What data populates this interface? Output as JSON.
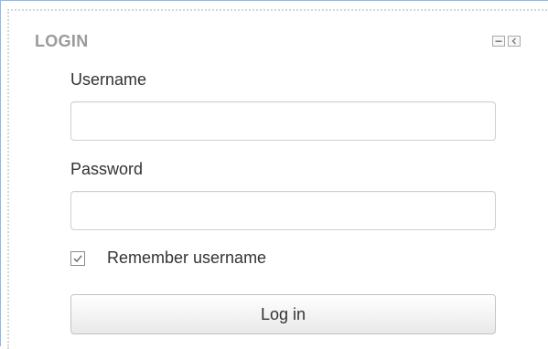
{
  "login_block": {
    "title": "LOGIN",
    "controls": [
      {
        "name": "minimize-icon"
      },
      {
        "name": "dock-icon"
      }
    ],
    "username": {
      "label": "Username",
      "value": "",
      "placeholder": ""
    },
    "password": {
      "label": "Password",
      "value": "",
      "placeholder": ""
    },
    "remember": {
      "label": "Remember username",
      "checked": true
    },
    "submit_label": "Log in"
  },
  "colors": {
    "title": "#9a9a9a",
    "text": "#333333",
    "frame_border": "#9fb6cf",
    "input_border": "#cfcfcf"
  }
}
